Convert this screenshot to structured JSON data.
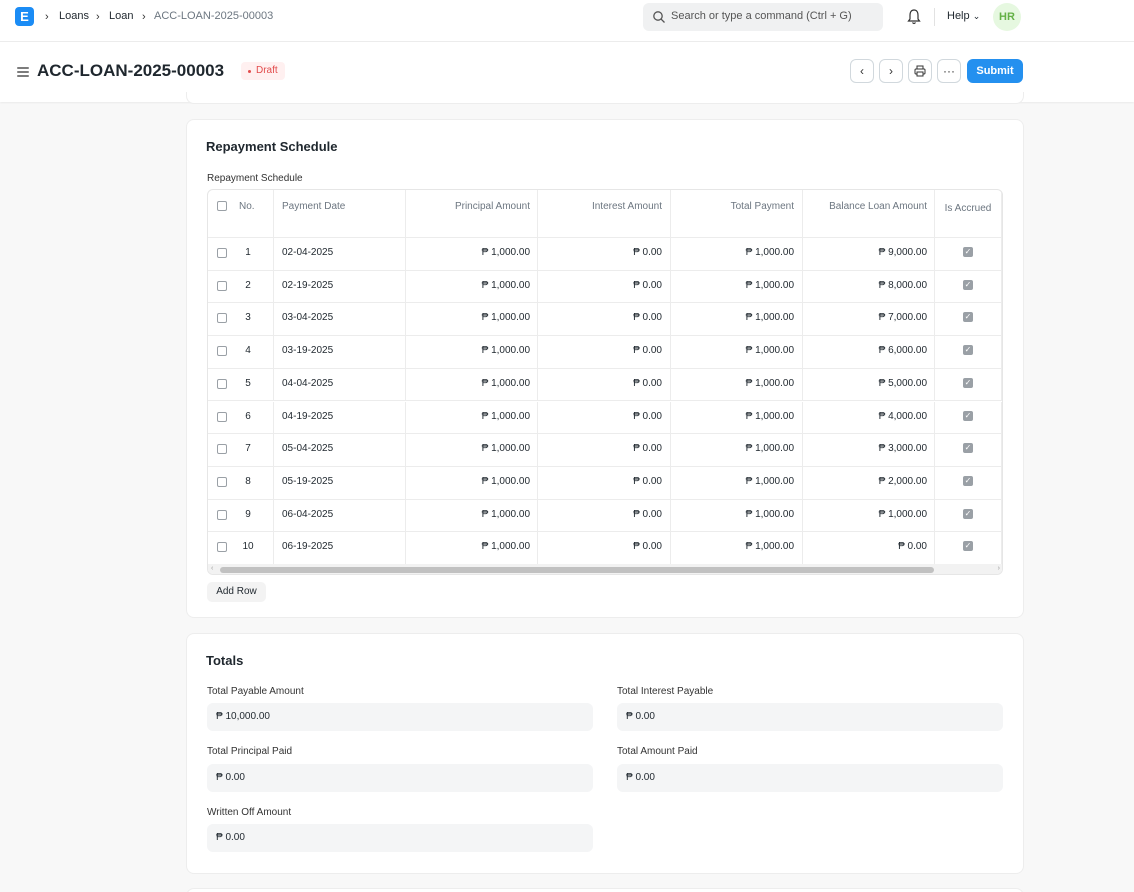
{
  "navbar": {
    "logo_letter": "E",
    "breadcrumbs": [
      "Loans",
      "Loan",
      "ACC-LOAN-2025-00003"
    ],
    "search_placeholder": "Search or type a command (Ctrl + G)",
    "help_label": "Help",
    "avatar_initials": "HR"
  },
  "page": {
    "title": "ACC-LOAN-2025-00003",
    "status": "Draft",
    "submit_label": "Submit"
  },
  "repayment": {
    "section_title": "Repayment Schedule",
    "table_label": "Repayment Schedule",
    "columns": [
      "No.",
      "Payment Date",
      "Principal Amount",
      "Interest Amount",
      "Total Payment",
      "Balance Loan Amount",
      "Is Accrued"
    ],
    "rows": [
      {
        "no": "1",
        "date": "02-04-2025",
        "principal": "₱ 1,000.00",
        "interest": "₱ 0.00",
        "total": "₱ 1,000.00",
        "balance": "₱ 9,000.00",
        "accrued": true
      },
      {
        "no": "2",
        "date": "02-19-2025",
        "principal": "₱ 1,000.00",
        "interest": "₱ 0.00",
        "total": "₱ 1,000.00",
        "balance": "₱ 8,000.00",
        "accrued": true
      },
      {
        "no": "3",
        "date": "03-04-2025",
        "principal": "₱ 1,000.00",
        "interest": "₱ 0.00",
        "total": "₱ 1,000.00",
        "balance": "₱ 7,000.00",
        "accrued": true
      },
      {
        "no": "4",
        "date": "03-19-2025",
        "principal": "₱ 1,000.00",
        "interest": "₱ 0.00",
        "total": "₱ 1,000.00",
        "balance": "₱ 6,000.00",
        "accrued": true
      },
      {
        "no": "5",
        "date": "04-04-2025",
        "principal": "₱ 1,000.00",
        "interest": "₱ 0.00",
        "total": "₱ 1,000.00",
        "balance": "₱ 5,000.00",
        "accrued": true
      },
      {
        "no": "6",
        "date": "04-19-2025",
        "principal": "₱ 1,000.00",
        "interest": "₱ 0.00",
        "total": "₱ 1,000.00",
        "balance": "₱ 4,000.00",
        "accrued": true
      },
      {
        "no": "7",
        "date": "05-04-2025",
        "principal": "₱ 1,000.00",
        "interest": "₱ 0.00",
        "total": "₱ 1,000.00",
        "balance": "₱ 3,000.00",
        "accrued": true
      },
      {
        "no": "8",
        "date": "05-19-2025",
        "principal": "₱ 1,000.00",
        "interest": "₱ 0.00",
        "total": "₱ 1,000.00",
        "balance": "₱ 2,000.00",
        "accrued": true
      },
      {
        "no": "9",
        "date": "06-04-2025",
        "principal": "₱ 1,000.00",
        "interest": "₱ 0.00",
        "total": "₱ 1,000.00",
        "balance": "₱ 1,000.00",
        "accrued": true
      },
      {
        "no": "10",
        "date": "06-19-2025",
        "principal": "₱ 1,000.00",
        "interest": "₱ 0.00",
        "total": "₱ 1,000.00",
        "balance": "₱ 0.00",
        "accrued": true
      }
    ],
    "add_row_label": "Add Row"
  },
  "totals": {
    "section_title": "Totals",
    "total_payable_label": "Total Payable Amount",
    "total_payable_value": "₱ 10,000.00",
    "total_interest_label": "Total Interest Payable",
    "total_interest_value": "₱ 0.00",
    "principal_paid_label": "Total Principal Paid",
    "principal_paid_value": "₱ 0.00",
    "amount_paid_label": "Total Amount Paid",
    "amount_paid_value": "₱ 0.00",
    "written_off_label": "Written Off Amount",
    "written_off_value": "₱ 0.00"
  },
  "colors": {
    "primary": "#2490ef",
    "draft": "#e24c4c",
    "avatar_text": "#64b146"
  }
}
